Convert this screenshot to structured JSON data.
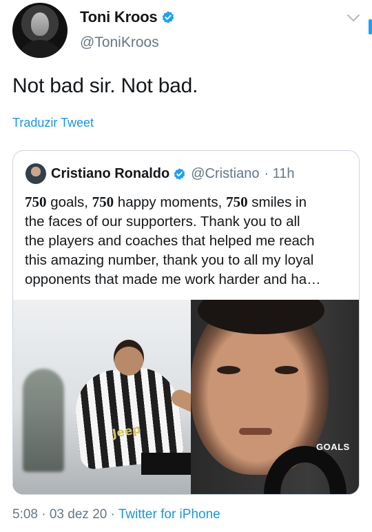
{
  "author": {
    "display_name": "Toni Kroos",
    "handle": "@ToniKroos"
  },
  "tweet": {
    "text": "Not bad sir. Not bad.",
    "translate_label": "Traduzir Tweet"
  },
  "quoted": {
    "display_name": "Cristiano Ronaldo",
    "handle": "@Cristiano",
    "time": "· 11h",
    "lines": [
      {
        "num": "750",
        "rest": " goals, "
      },
      {
        "num": "750",
        "rest": " happy moments, "
      },
      {
        "num": "750",
        "rest": " smiles in"
      }
    ],
    "line2": "the faces of our supporters. Thank you to all",
    "line3": "the players and coaches that helped me reach",
    "line4": "this amazing number, thank you to all my loyal",
    "line5": "opponents that made me work harder and ha…",
    "media_label": "GOALS",
    "jersey_text": "Jeep"
  },
  "footer": {
    "time": "5:08 · 03 dez 20 · ",
    "source": "Twitter for iPhone"
  },
  "colors": {
    "link": "#1b95e0",
    "verified": "#1da1f2",
    "secondary_text": "#657786"
  }
}
